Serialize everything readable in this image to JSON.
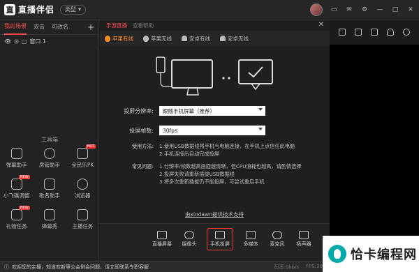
{
  "app": {
    "title": "直播伴侣",
    "mode": "类型"
  },
  "left": {
    "tabs": [
      "我的场景",
      "双击",
      "可改名"
    ],
    "scene": {
      "name": "窗口 1"
    },
    "tools_title": "工具箱",
    "tools": [
      {
        "label": "弹幕助手",
        "badge": ""
      },
      {
        "label": "房管助手",
        "badge": ""
      },
      {
        "label": "全民乐PK",
        "badge": "HOT"
      },
      {
        "label": "小飞碟调整",
        "badge": "NEW"
      },
      {
        "label": "歌名助手",
        "badge": ""
      },
      {
        "label": "浏览器",
        "badge": ""
      },
      {
        "label": "礼物任务",
        "badge": "NEW"
      },
      {
        "label": "弹幕秀",
        "badge": ""
      },
      {
        "label": "主播任务",
        "badge": ""
      }
    ]
  },
  "center": {
    "head": {
      "active": "手游直播",
      "inactive": "查看帮助"
    },
    "conn_tabs": [
      "苹果有线",
      "苹果无线",
      "安卓有线",
      "安卓无线"
    ],
    "resolution": {
      "label": "投屏分辨率:",
      "value": "跟随手机屏幕（推荐）"
    },
    "fps": {
      "label": "投屏帧数:",
      "value": "30fps"
    },
    "usage": {
      "label": "使用方法:",
      "lines": [
        "1.使用USB数据线将手机与电脑连接，在手机上点信任此电脑",
        "2.手机连接后自动完成投屏"
      ]
    },
    "faq": {
      "label": "常见问题:",
      "lines": [
        "1.分辨率/帧数越高画面越清晰，但CPU消耗也越高，请酌情选择",
        "2.投屏失败请重新插拔USB数据线",
        "3.将多次重新插拔仍不能投屏，可尝试重启手机"
      ]
    },
    "footer": "由xindawn提供技术支持",
    "bottom": [
      "直播屏幕",
      "摄像头",
      "手机投屏",
      "多媒体",
      "麦克风",
      "扬声器"
    ]
  },
  "status": {
    "text": "欢迎您的主播，知道欢新等公会例会问题，请立即联系专职客服",
    "right": [
      "码率:0kb/s",
      "FPS:30"
    ]
  },
  "watermark": "恰卡编程网"
}
